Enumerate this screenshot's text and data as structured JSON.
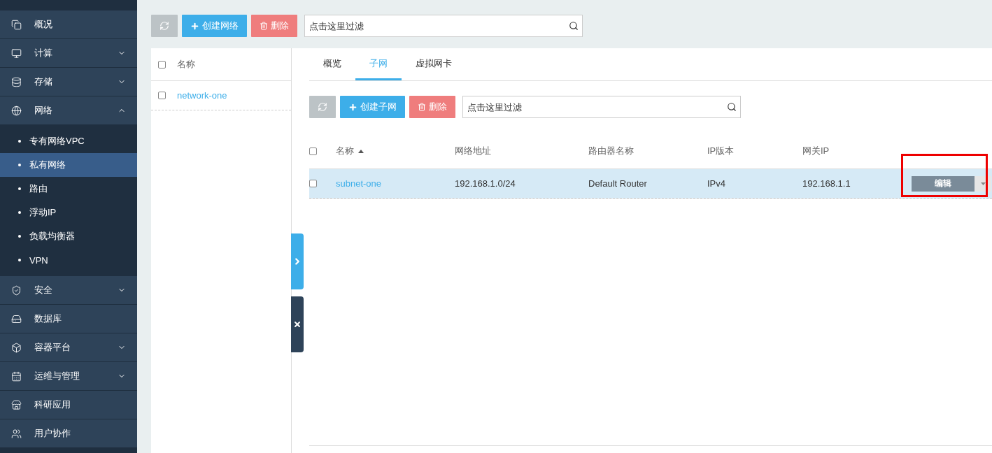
{
  "sidebar": {
    "items": [
      {
        "label": "概况",
        "selected": false
      },
      {
        "label": "计算",
        "expanded": false,
        "selected": false
      },
      {
        "label": "存储",
        "expanded": false,
        "selected": false
      },
      {
        "label": "网络",
        "expanded": true,
        "selected": false,
        "children": [
          {
            "label": "专有网络VPC",
            "selected": false
          },
          {
            "label": "私有网络",
            "selected": true
          },
          {
            "label": "路由",
            "selected": false
          },
          {
            "label": "浮动IP",
            "selected": false
          },
          {
            "label": "负载均衡器",
            "selected": false
          },
          {
            "label": "VPN",
            "selected": false
          }
        ]
      },
      {
        "label": "安全",
        "expanded": false,
        "selected": false
      },
      {
        "label": "数据库",
        "selected": false
      },
      {
        "label": "容器平台",
        "expanded": false,
        "selected": false
      },
      {
        "label": "运维与管理",
        "expanded": false,
        "selected": false
      },
      {
        "label": "科研应用",
        "selected": false
      },
      {
        "label": "用户协作",
        "selected": false
      }
    ]
  },
  "toolbar": {
    "create_label": "创建网络",
    "delete_label": "删除",
    "filter": {
      "placeholder": "点击这里过滤"
    }
  },
  "network_list": {
    "header": "名称",
    "checked": false,
    "rows": [
      {
        "name": "network-one",
        "checked": false
      }
    ]
  },
  "detail": {
    "tabs": [
      {
        "label": "概览",
        "selected": false
      },
      {
        "label": "子网",
        "selected": true
      },
      {
        "label": "虚拟网卡",
        "selected": false
      }
    ],
    "toolbar": {
      "create_label": "创建子网",
      "delete_label": "删除",
      "filter": {
        "placeholder": "点击这里过滤"
      }
    },
    "table": {
      "checked": false,
      "columns": [
        {
          "label": "名称",
          "sorted": true
        },
        {
          "label": "网络地址",
          "sorted": false
        },
        {
          "label": "路由器名称",
          "sorted": false
        },
        {
          "label": "IP版本",
          "sorted": false
        },
        {
          "label": "网关IP",
          "sorted": false
        }
      ],
      "rows": [
        {
          "cells": [
            "subnet-one",
            "192.168.1.0/24",
            "Default Router",
            "IPv4",
            "192.168.1.1"
          ],
          "checked": false,
          "selected": true,
          "action": "编辑",
          "highlighted": true
        }
      ]
    }
  }
}
